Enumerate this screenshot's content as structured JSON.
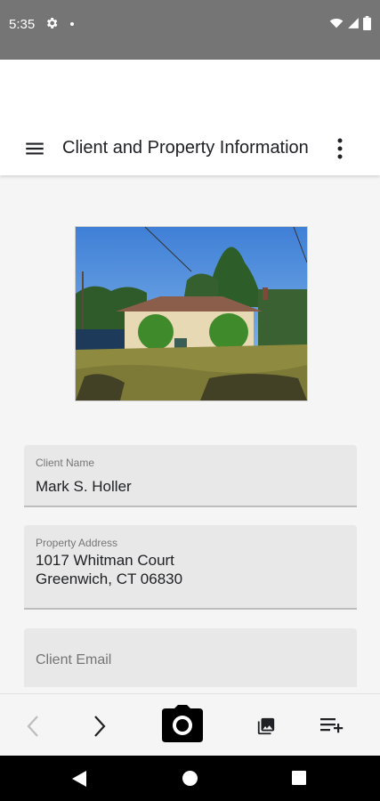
{
  "status_bar": {
    "time": "5:35",
    "icons": [
      "settings-icon",
      "notification-dot",
      "wifi-icon",
      "signal-icon",
      "battery-icon"
    ]
  },
  "app_bar": {
    "title": "Client and Property Information",
    "menu_icon": "hamburger-menu-icon",
    "more_icon": "more-vert-icon"
  },
  "fields": {
    "client_name": {
      "label": "Client Name",
      "value": "Mark S. Holler"
    },
    "property_address": {
      "label": "Property Address",
      "line1": "1017 Whitman Court",
      "line2": "Greenwich, CT 06830"
    },
    "client_email": {
      "placeholder": "Client Email"
    }
  },
  "bottom_toolbar": [
    "back-icon",
    "forward-icon",
    "camera-icon",
    "gallery-icon",
    "playlist-add-icon"
  ],
  "colors": {
    "status_bar": "#757575",
    "field_bg": "#e8e8e8",
    "background": "#f5f5f5"
  }
}
